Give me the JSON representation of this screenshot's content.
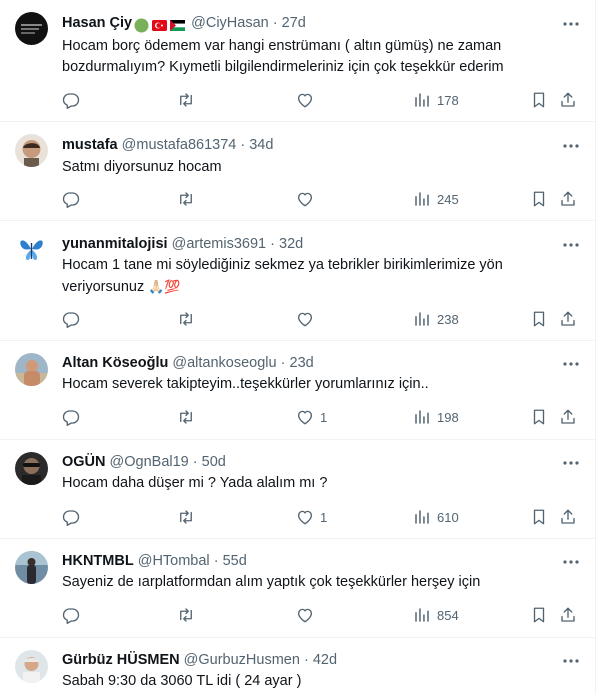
{
  "tweets": [
    {
      "name": "Hasan Çiy",
      "handle": "@CiyHasan",
      "separator": "·",
      "time": "27d",
      "lines": [
        "Hocam borç ödemem var hangi enstrümanı ( altın gümüş) ne zaman",
        "bozdurmalıyım? Kıymetli bilgilendirmeleriniz için çok teşekkür ederim"
      ],
      "likes": "",
      "views": "178"
    },
    {
      "name": "mustafa",
      "handle": "@mustafa861374",
      "separator": "·",
      "time": "34d",
      "lines": [
        "Satmı diyorsunuz hocam"
      ],
      "likes": "",
      "views": "245"
    },
    {
      "name": "yunanmitalojisi",
      "handle": "@artemis3691",
      "separator": "·",
      "time": "32d",
      "lines": [
        "Hocam 1 tane mi söylediğiniz sekmez ya tebrikler birikimlerimize yön",
        "veriyorsunuz"
      ],
      "emoji": "🙏🏻💯",
      "likes": "",
      "views": "238"
    },
    {
      "name": "Altan Köseoğlu",
      "handle": "@altankoseoglu",
      "separator": "·",
      "time": "23d",
      "lines": [
        "Hocam severek takipteyim..teşekkürler yorumlarınız için.."
      ],
      "likes": "1",
      "views": "198"
    },
    {
      "name": "OGÜN",
      "handle": "@OgnBal19",
      "separator": "·",
      "time": "50d",
      "lines": [
        "Hocam daha düşer mi ? Yada alalım mı ?"
      ],
      "likes": "1",
      "views": "610"
    },
    {
      "name": "HKNTMBL",
      "handle": "@HTombal",
      "separator": "·",
      "time": "55d",
      "lines": [
        "Sayeniz de ıarplatformdan alım yaptık çok teşekkürler herşey için"
      ],
      "likes": "",
      "views": "854"
    },
    {
      "name": "Gürbüz HÜSMEN",
      "handle": "@GurbuzHusmen",
      "separator": "·",
      "time": "42d",
      "lines": [
        "Sabah 9:30 da 3060 TL idi ( 24 ayar )"
      ],
      "likes": "",
      "views": ""
    }
  ],
  "icons": {
    "more": "more-icon",
    "reply": "reply-icon",
    "retweet": "retweet-icon",
    "like": "like-icon",
    "views": "views-icon",
    "bookmark": "bookmark-icon",
    "share": "share-icon"
  },
  "colors": {
    "text": "#0f1419",
    "secondary": "#536471",
    "divider": "#eff3f4"
  }
}
